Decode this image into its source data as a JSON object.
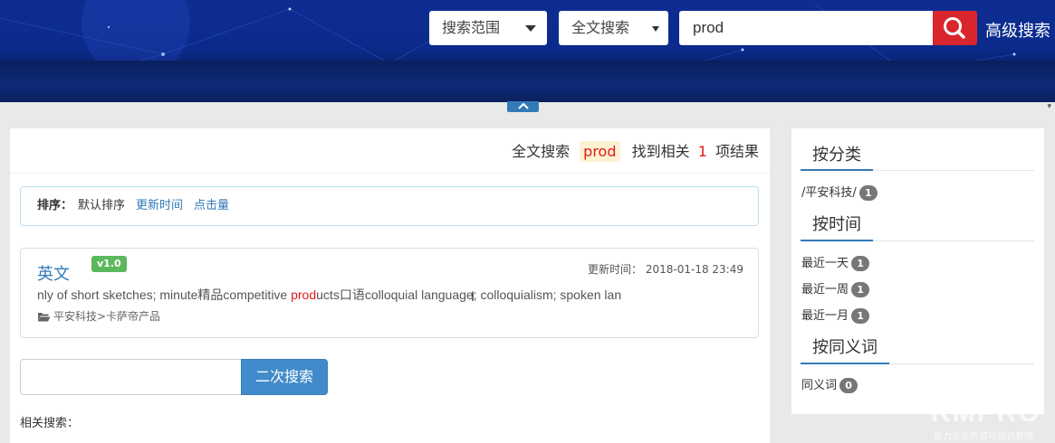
{
  "header": {
    "scope_label": "搜索范围",
    "mode_label": "全文搜索",
    "search_value": "prod",
    "advanced_label": "高级搜索",
    "accent_color": "#d9262c"
  },
  "summary": {
    "mode": "全文搜索",
    "keyword": "prod",
    "found_prefix": "找到相关",
    "count": "1",
    "found_suffix": "项结果"
  },
  "sort": {
    "label": "排序：",
    "default": "默认排序",
    "by_time": "更新时间",
    "by_clicks": "点击量"
  },
  "result": {
    "title": "英文",
    "version": "v1.0",
    "time_label": "更新时间：",
    "time_value": "2018-01-18 23:49",
    "snippet_before": "nly of short sketches; minute精品competitive ",
    "snippet_highlight": "prod",
    "snippet_after": "ucts口语colloquial language; colloquialism; spoken lan",
    "path": "平安科技>卡萨帝产品",
    "folder_icon": "folder-open-icon"
  },
  "secondary": {
    "button_label": "二次搜索",
    "related_label": "相关搜索："
  },
  "sidebar": {
    "category_title": "按分类",
    "categories": [
      {
        "label": "/平安科技/",
        "count": "1"
      }
    ],
    "time_title": "按时间",
    "times": [
      {
        "label": "最近一天",
        "count": "1"
      },
      {
        "label": "最近一周",
        "count": "1"
      },
      {
        "label": "最近一月",
        "count": "1"
      }
    ],
    "synonym_title": "按同义词",
    "synonyms": [
      {
        "label": "同义词",
        "count": "0"
      }
    ]
  },
  "watermark": {
    "brand": "KMPRO",
    "slogan": "致力企业内容与知识管理"
  }
}
